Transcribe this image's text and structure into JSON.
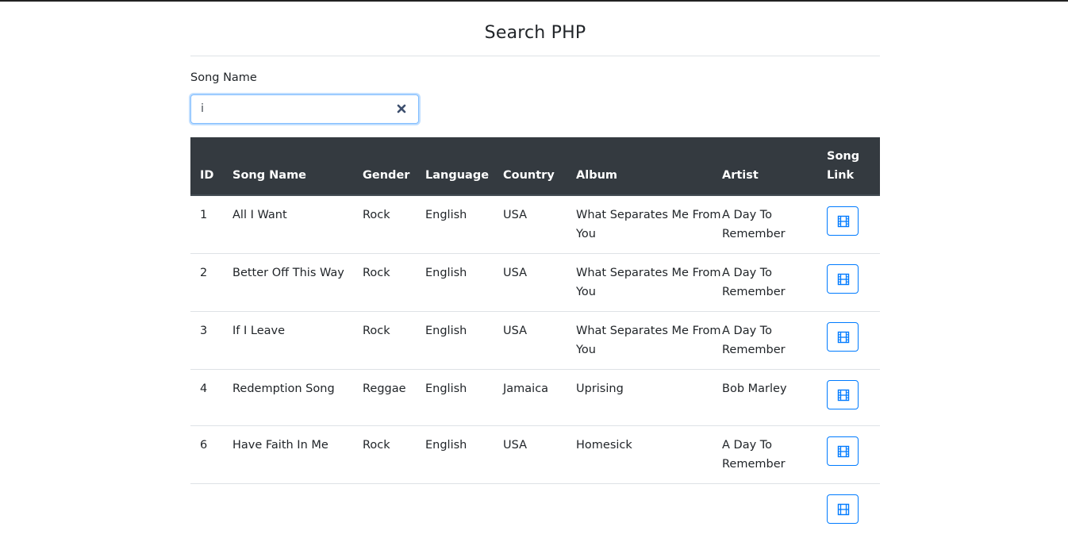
{
  "page": {
    "title": "Search PHP"
  },
  "search": {
    "label": "Song Name",
    "value": "i",
    "clear_icon": "close-icon"
  },
  "table": {
    "headers": {
      "id": "ID",
      "song_name": "Song Name",
      "gender": "Gender",
      "language": "Language",
      "country": "Country",
      "album": "Album",
      "artist": "Artist",
      "song_link": "Song Link"
    },
    "rows": [
      {
        "id": "1",
        "song_name": "All I Want",
        "gender": "Rock",
        "language": "English",
        "country": "USA",
        "album": "What Separates Me From You",
        "artist": "A Day To Remember",
        "link_icon": "film-icon"
      },
      {
        "id": "2",
        "song_name": "Better Off This Way",
        "gender": "Rock",
        "language": "English",
        "country": "USA",
        "album": "What Separates Me From You",
        "artist": "A Day To Remember",
        "link_icon": "film-icon"
      },
      {
        "id": "3",
        "song_name": "If I Leave",
        "gender": "Rock",
        "language": "English",
        "country": "USA",
        "album": "What Separates Me From You",
        "artist": "A Day To Remember",
        "link_icon": "film-icon"
      },
      {
        "id": "4",
        "song_name": "Redemption Song",
        "gender": "Reggae",
        "language": "English",
        "country": "Jamaica",
        "album": "Uprising",
        "artist": "Bob Marley",
        "link_icon": "film-icon"
      },
      {
        "id": "6",
        "song_name": "Have Faith In Me",
        "gender": "Rock",
        "language": "English",
        "country": "USA",
        "album": "Homesick",
        "artist": "A Day To Remember",
        "link_icon": "film-icon"
      }
    ]
  },
  "colors": {
    "header_bg": "#343a40",
    "accent": "#007bff",
    "focus_border": "#80bdff"
  }
}
